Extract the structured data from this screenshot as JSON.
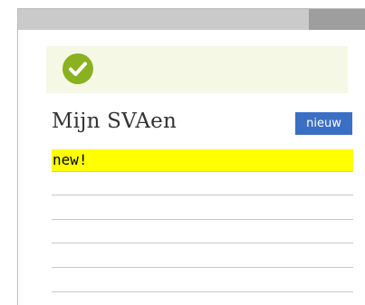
{
  "page": {
    "title": "Mijn SVAen",
    "new_button_label": "nieuw",
    "highlight_text": "new!"
  },
  "banner": {
    "icon": "check-circle-icon",
    "color": "#8ab11f"
  },
  "colors": {
    "accent_button": "#3a6fc4",
    "highlight": "#ffff00",
    "banner_bg": "#f4f8e5"
  },
  "list": {
    "rows": [
      "",
      "",
      "",
      "",
      "",
      ""
    ]
  }
}
